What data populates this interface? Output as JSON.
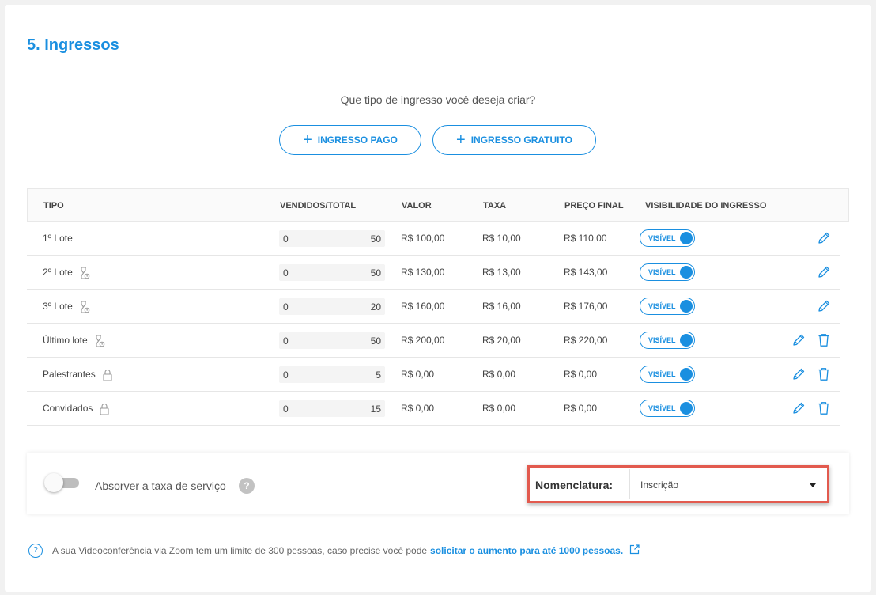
{
  "section": {
    "title": "5. Ingressos"
  },
  "create": {
    "question": "Que tipo de ingresso você deseja criar?",
    "paid_label": "INGRESSO PAGO",
    "free_label": "INGRESSO GRATUITO"
  },
  "table": {
    "headers": {
      "tipo": "TIPO",
      "vendidos": "VENDIDOS/TOTAL",
      "valor": "VALOR",
      "taxa": "TAXA",
      "preco": "PREÇO FINAL",
      "visibilidade": "VISIBILIDADE DO INGRESSO"
    },
    "rows": [
      {
        "name": "1º Lote",
        "icon": "",
        "sold": "0",
        "total": "50",
        "valor": "R$ 100,00",
        "taxa": "R$ 10,00",
        "preco": "R$ 110,00",
        "visibility": "VISÍVEL",
        "deletable": false
      },
      {
        "name": "2º Lote",
        "icon": "hourglass-icon",
        "sold": "0",
        "total": "50",
        "valor": "R$ 130,00",
        "taxa": "R$ 13,00",
        "preco": "R$ 143,00",
        "visibility": "VISÍVEL",
        "deletable": false
      },
      {
        "name": "3º Lote",
        "icon": "hourglass-icon",
        "sold": "0",
        "total": "20",
        "valor": "R$ 160,00",
        "taxa": "R$ 16,00",
        "preco": "R$ 176,00",
        "visibility": "VISÍVEL",
        "deletable": false
      },
      {
        "name": "Último lote",
        "icon": "hourglass-icon",
        "sold": "0",
        "total": "50",
        "valor": "R$ 200,00",
        "taxa": "R$ 20,00",
        "preco": "R$ 220,00",
        "visibility": "VISÍVEL",
        "deletable": true
      },
      {
        "name": "Palestrantes",
        "icon": "lock-icon",
        "sold": "0",
        "total": "5",
        "valor": "R$ 0,00",
        "taxa": "R$ 0,00",
        "preco": "R$ 0,00",
        "visibility": "VISÍVEL",
        "deletable": true
      },
      {
        "name": "Convidados",
        "icon": "lock-icon",
        "sold": "0",
        "total": "15",
        "valor": "R$ 0,00",
        "taxa": "R$ 0,00",
        "preco": "R$ 0,00",
        "visibility": "VISÍVEL",
        "deletable": true
      }
    ]
  },
  "service_fee": {
    "label": "Absorver a taxa de serviço",
    "help": "?",
    "enabled": false
  },
  "nomenclature": {
    "label": "Nomenclatura:",
    "value": "Inscrição"
  },
  "notice": {
    "icon_text": "?",
    "text": "A sua Videoconferência via Zoom tem um limite de 300 pessoas, caso precise você pode",
    "link": "solicitar o aumento para até 1000 pessoas."
  },
  "colors": {
    "accent": "#1a8fe0",
    "highlight_border": "#e25a4e"
  }
}
